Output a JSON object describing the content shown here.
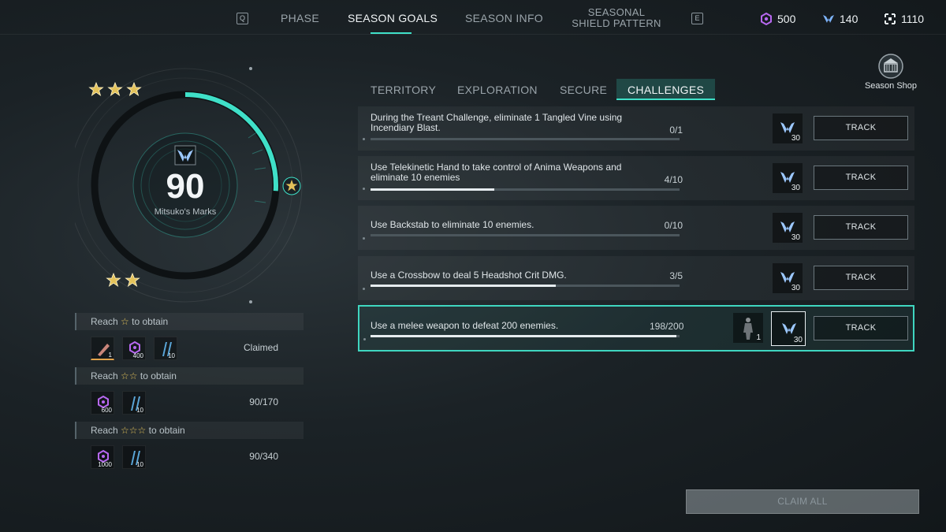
{
  "topbar": {
    "key_left": "Q",
    "key_right": "E",
    "tabs": [
      "PHASE",
      "SEASON GOALS",
      "SEASON INFO",
      "SEASONAL",
      "SHIELD PATTERN"
    ],
    "currencies": [
      {
        "icon": "gem-icon",
        "value": "500",
        "color": "#b768f0"
      },
      {
        "icon": "mitsuko-mark-icon",
        "value": "140",
        "color": "#7fb6ff"
      },
      {
        "icon": "frame-icon",
        "value": "1110",
        "color": "#e8eef1"
      }
    ]
  },
  "season_shop": {
    "label": "Season Shop"
  },
  "marks": {
    "value": "90",
    "label": "Mitsuko's Marks",
    "progress": 0.26,
    "accent": "#3fe0c8"
  },
  "rewards": [
    {
      "head_pre": "Reach",
      "stars": 1,
      "head_post": "to obtain",
      "items": [
        {
          "icon": "feather-icon",
          "qty": "1"
        },
        {
          "icon": "gem-icon",
          "qty": "400"
        },
        {
          "icon": "shard-icon",
          "qty": "10"
        }
      ],
      "status": "Claimed"
    },
    {
      "head_pre": "Reach",
      "stars": 2,
      "head_post": "to obtain",
      "items": [
        {
          "icon": "gem-icon",
          "qty": "600"
        },
        {
          "icon": "shard-icon",
          "qty": "10"
        }
      ],
      "status": "90/170"
    },
    {
      "head_pre": "Reach",
      "stars": 3,
      "head_post": "to obtain",
      "items": [
        {
          "icon": "gem-icon",
          "qty": "1000"
        },
        {
          "icon": "shard-icon",
          "qty": "10"
        }
      ],
      "status": "90/340"
    }
  ],
  "subtabs": [
    "TERRITORY",
    "EXPLORATION",
    "SECURE",
    "CHALLENGES"
  ],
  "challenges": [
    {
      "text": "During the Treant Challenge, eliminate 1 Tangled Vine using Incendiary Blast.",
      "progress": "0/1",
      "fraction": 0.0,
      "reward_qty": "30",
      "button": "TRACK"
    },
    {
      "text": "Use Telekinetic Hand to take control of Anima Weapons and eliminate 10 enemies",
      "progress": "4/10",
      "fraction": 0.4,
      "reward_qty": "30",
      "button": "TRACK"
    },
    {
      "text": "Use Backstab to eliminate 10 enemies.",
      "progress": "0/10",
      "fraction": 0.0,
      "reward_qty": "30",
      "button": "TRACK"
    },
    {
      "text": "Use a Crossbow to deal 5 Headshot Crit DMG.",
      "progress": "3/5",
      "fraction": 0.6,
      "reward_qty": "30",
      "button": "TRACK"
    },
    {
      "text": "Use a melee weapon to defeat 200 enemies.",
      "progress": "198/200",
      "fraction": 0.99,
      "reward_qty": "30",
      "extra_qty": "1",
      "button": "TRACK"
    }
  ],
  "claim_all": "CLAIM ALL"
}
